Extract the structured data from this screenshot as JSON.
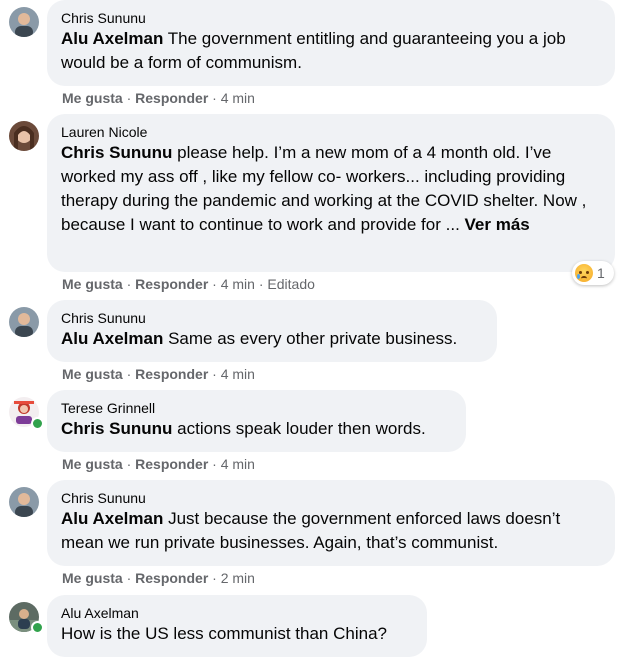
{
  "comments": [
    {
      "author": "Chris Sununu",
      "mention": "Alu Axelman",
      "text": " The government entitling and guaranteeing you a job would be a form of communism.",
      "like": "Me gusta",
      "reply": "Responder",
      "time": "4 min"
    },
    {
      "author": "Lauren Nicole",
      "mention": "Chris Sununu",
      "text": " please help. I’m a new mom of a 4 month old. I’ve worked my ass off , like my fellow co- workers... including providing therapy during the pandemic and working at the COVID shelter. Now , because I want to continue to work and provide for ... ",
      "see_more": "Ver más",
      "like": "Me gusta",
      "reply": "Responder",
      "time": "4 min",
      "edited": "Editado",
      "reaction_count": "1",
      "reaction_icon": "sad-face-icon"
    },
    {
      "author": "Chris Sununu",
      "mention": "Alu Axelman",
      "text": " Same as every other private business.",
      "like": "Me gusta",
      "reply": "Responder",
      "time": "4 min"
    },
    {
      "author": "Terese Grinnell",
      "mention": "Chris Sununu",
      "text": " actions speak louder then words.",
      "like": "Me gusta",
      "reply": "Responder",
      "time": "4 min"
    },
    {
      "author": "Chris Sununu",
      "mention": "Alu Axelman",
      "text": " Just because the government enforced laws doesn’t mean we run private businesses. Again, that’s communist.",
      "like": "Me gusta",
      "reply": "Responder",
      "time": "2 min"
    },
    {
      "author": "Alu Axelman",
      "text": "How is the US less communist than China?"
    }
  ],
  "separator": " · ",
  "colors": {
    "bubble": "#f0f2f5",
    "meta_text": "#65676b",
    "online": "#31a24c"
  }
}
